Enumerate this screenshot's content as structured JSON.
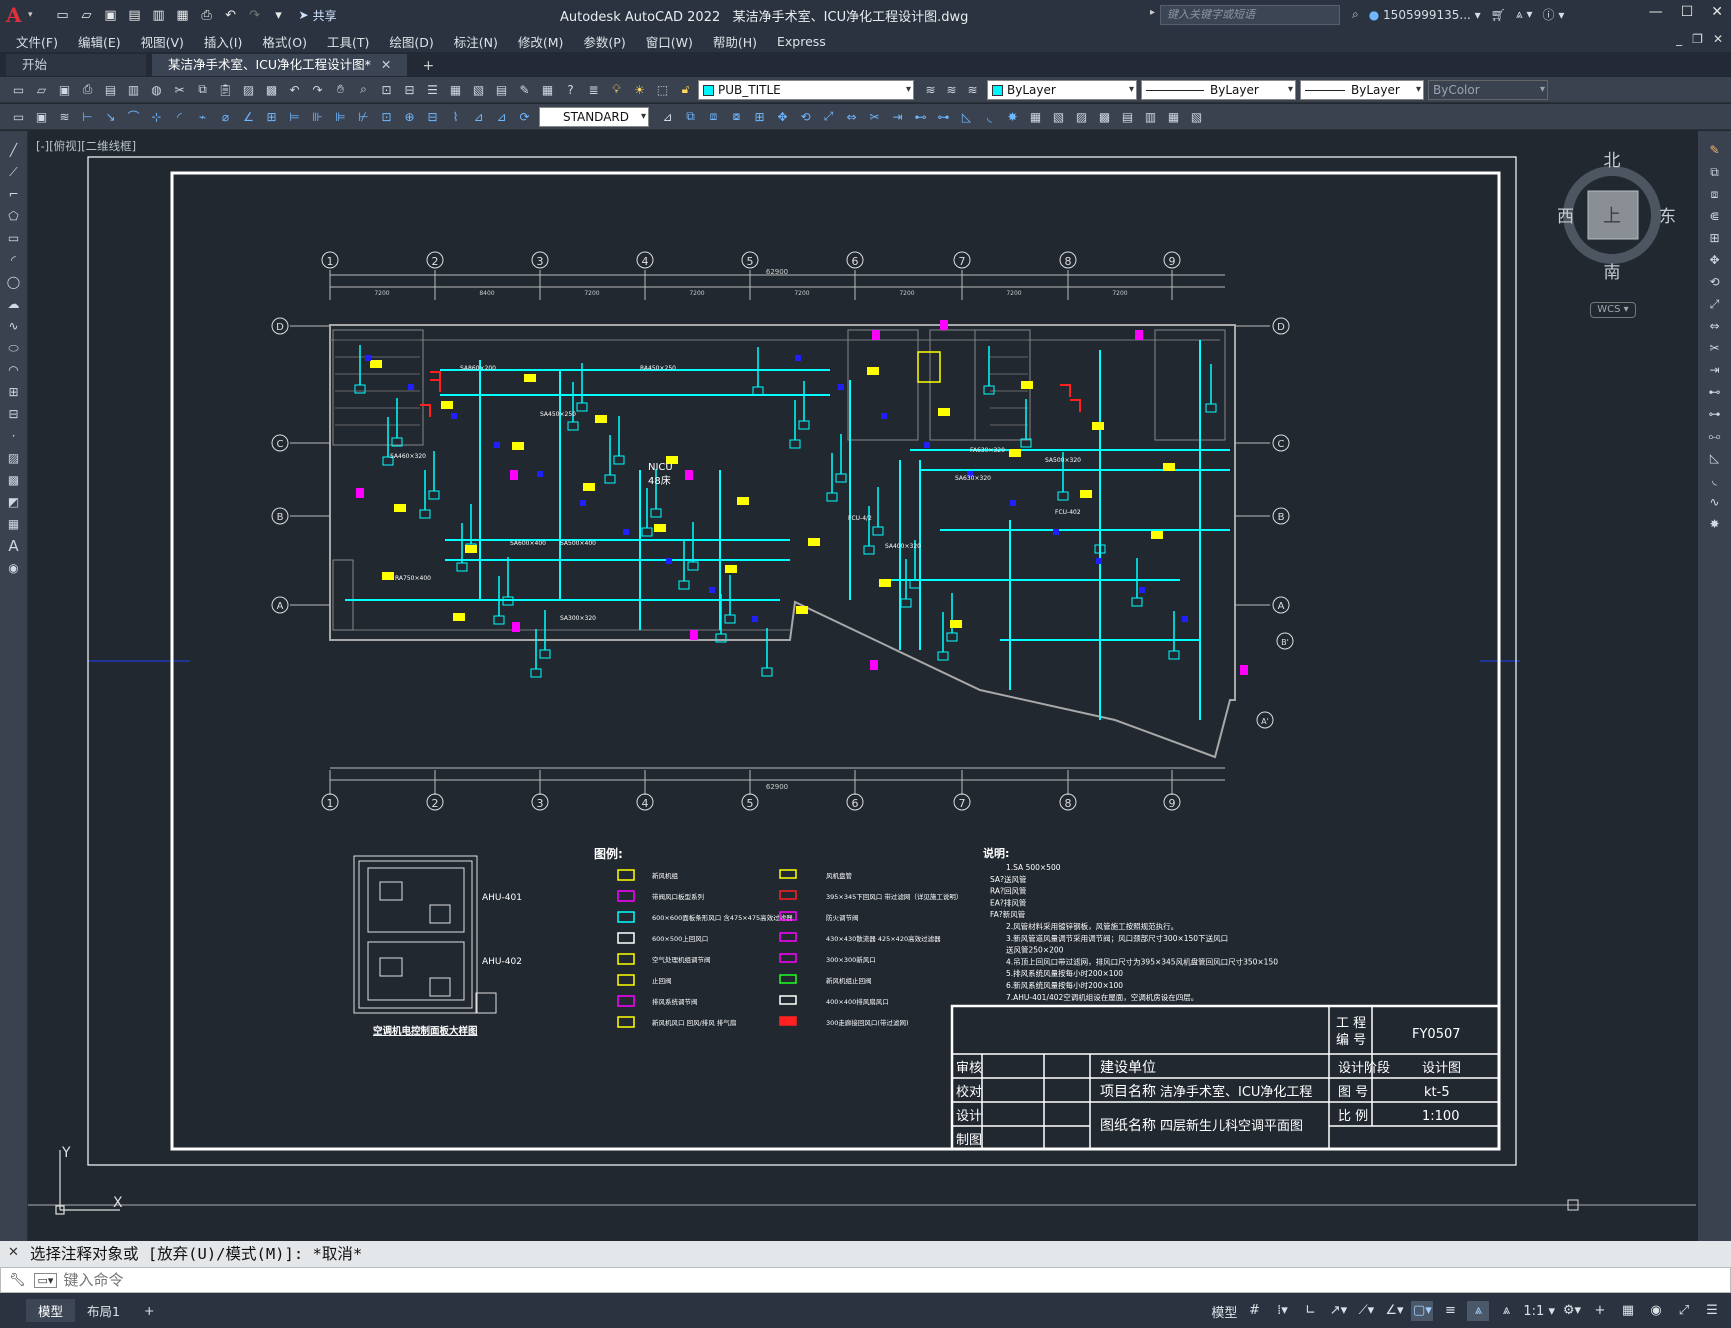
{
  "app": {
    "name": "Autodesk AutoCAD 2022",
    "file": "某洁净手术室、ICU净化工程设计图.dwg",
    "share": "共享",
    "search_placeholder": "键入关键字或短语",
    "user": "1505999135..."
  },
  "menu": [
    "文件(F)",
    "编辑(E)",
    "视图(V)",
    "插入(I)",
    "格式(O)",
    "工具(T)",
    "绘图(D)",
    "标注(N)",
    "修改(M)",
    "参数(P)",
    "窗口(W)",
    "帮助(H)",
    "Express"
  ],
  "tabs": [
    {
      "label": "开始"
    },
    {
      "label": "某洁净手术室、ICU净化工程设计图*"
    }
  ],
  "props": {
    "layer": "PUB_TITLE",
    "color": "ByLayer",
    "linetype": "ByLayer",
    "lineweight": "ByLayer",
    "plotstyle": "ByColor",
    "textstyle": "STANDARD"
  },
  "viewport_label": "[-][俯视][二维线框]",
  "viewcube": {
    "n": "北",
    "s": "南",
    "e": "东",
    "w": "西",
    "top": "上",
    "wcs": "WCS"
  },
  "drawing": {
    "axis_numbers": [
      "①",
      "②",
      "③",
      "④",
      "⑤",
      "⑥",
      "⑦",
      "⑧",
      "⑨"
    ],
    "axis_letters_left": [
      "D",
      "C",
      "B",
      "A"
    ],
    "axis_letters_right": [
      "D",
      "C",
      "B",
      "A",
      "B'",
      "A'"
    ],
    "overall_dim": "62900",
    "dims_top": [
      "7200",
      "8400",
      "7200",
      "7200",
      "7200",
      "7200",
      "7200",
      "7200",
      "7200"
    ],
    "room_labels": [
      "NICU",
      "48床",
      "SA600×400",
      "SA500×400",
      "SA450×250",
      "RA750×400",
      "SA300×320",
      "SA630×320",
      "SA400×320",
      "FA630×320",
      "SA500×320",
      "FCU-4/2",
      "FCU-402",
      "SA460×320",
      "SA860×200",
      "RA450×250"
    ],
    "legend_title": "图例:",
    "legend_left": [
      "新风机组",
      "带阀风口板型系列",
      "600×600面板条形风口 含475×475高效过滤器",
      "600×500上回风口",
      "空气处理机组调节阀",
      "止回阀",
      "排风系统调节阀",
      "新风机风口 回风/排风 排气扇"
    ],
    "legend_right": [
      "风机盘管",
      "395×345下回风口 带过滤网（详见施工说明）",
      "防火调节阀",
      "430×430散流器 425×420高效过滤器",
      "300×300新风口",
      "新风机组止回阀",
      "400×400排风扇风口",
      "300走廊接回风口(带过滤网)"
    ],
    "notes_title": "说明:",
    "notes": [
      "1.SA 500×500",
      "SA?送风管",
      "RA?回风管",
      "EA?排风管",
      "FA?新风管",
      "2.风管材料采用镀锌钢板，风管施工按照规范执行。",
      "3.新风管道风量调节采用调节阀；风口颈部尺寸300×150下送风口",
      "  送风管250×200",
      "4.吊顶上回风口带过滤网，排风口尺寸为395×345风机盘管回风口尺寸350×150",
      "5.排风系统风量按每小时200×100",
      "6.新风系统风量按每小时200×100",
      "7.AHU-401/402空调机组设在屋面，空调机房设在四层。"
    ],
    "panel_labels": [
      "AHU-401",
      "AHU-402"
    ],
    "panel_caption": "空调机电控制面板大样图",
    "title_block": {
      "proj_no_label": "工 程 编 号",
      "proj_no": "FY0507",
      "rows": [
        {
          "role": "审核",
          "field": "建设单位",
          "val": "",
          "k": "设计阶段",
          "v": "设计图"
        },
        {
          "role": "校对",
          "field": "项目名称",
          "val": "洁净手术室、ICU净化工程",
          "k": "图 号",
          "v": "kt-5"
        },
        {
          "role": "设计",
          "field": "图纸名称",
          "val": "四层新生儿科空调平面图",
          "k": "比 例",
          "v": "1:100"
        },
        {
          "role": "制图",
          "field": "",
          "val": "",
          "k": "",
          "v": ""
        }
      ]
    }
  },
  "command": {
    "history": "选择注释对象或 [放弃(U)/模式(M)]: *取消*",
    "placeholder": "键入命令"
  },
  "status": {
    "tabs": [
      "模型",
      "布局1"
    ],
    "model": "模型",
    "scale": "1:1"
  },
  "colors": {
    "cyan": "#00ffff",
    "yellow": "#ffff00",
    "magenta": "#ff00ff",
    "blue": "#2020ff",
    "white": "#ffffff",
    "bg": "#212830"
  }
}
